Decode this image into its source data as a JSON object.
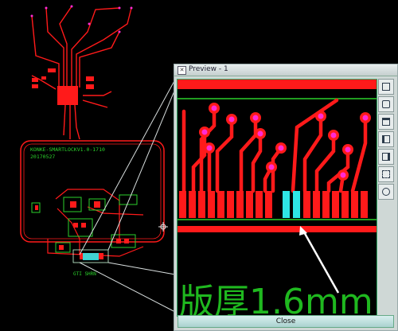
{
  "board": {
    "silk_line1": "KONKE-SMARTLOCKV1.0-1710",
    "silk_line2": "20170527",
    "silk_bottom": "GTI SHRN"
  },
  "preview_window": {
    "title": "Preview - 1",
    "close_label": "Close",
    "annotation": "版厚1.6mm"
  },
  "toolbar": {
    "icons": [
      "zoom-window-icon",
      "zoom-in-icon",
      "zoom-out-icon",
      "pan-left-icon",
      "pan-right-icon",
      "fit-all-icon",
      "center-icon"
    ]
  },
  "colors": {
    "copper": "#ff1a1a",
    "via_ring": "#ff2bd4",
    "outline": "#2bd12b",
    "highlight_pad": "#2ee6e6",
    "annotation_text": "#1fb81f"
  }
}
